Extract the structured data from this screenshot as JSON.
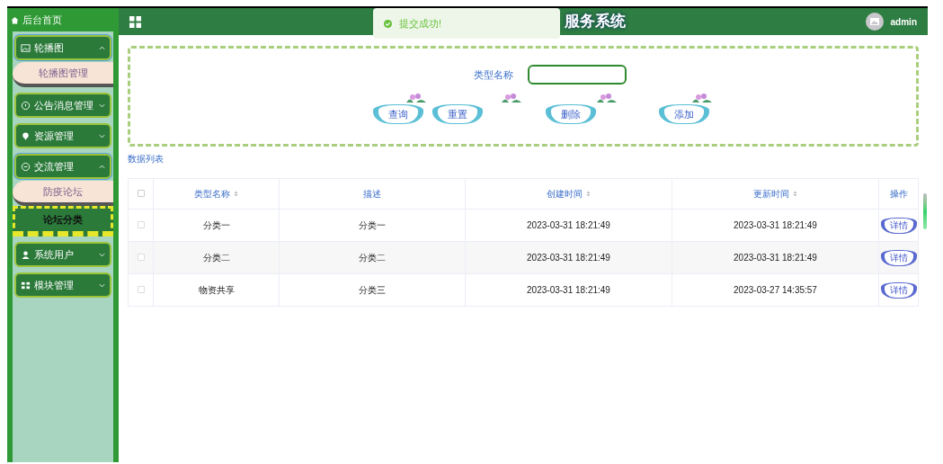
{
  "sidebar": {
    "home": "后台首页",
    "items": [
      {
        "label": "轮播图",
        "kind": "image",
        "expanded": true,
        "children": [
          {
            "label": "轮播图管理",
            "selected": false
          }
        ]
      },
      {
        "label": "公告消息管理",
        "kind": "info",
        "expanded": false
      },
      {
        "label": "资源管理",
        "kind": "pin",
        "expanded": false
      },
      {
        "label": "交流管理",
        "kind": "chat",
        "expanded": true,
        "children": [
          {
            "label": "防疫论坛",
            "selected": false
          },
          {
            "label": "论坛分类",
            "selected": true
          }
        ]
      },
      {
        "label": "系统用户",
        "kind": "user",
        "expanded": false
      },
      {
        "label": "模块管理",
        "kind": "grid",
        "expanded": false
      }
    ]
  },
  "header": {
    "title": "服务系统",
    "user": "admin"
  },
  "toast": {
    "message": "提交成功!"
  },
  "search": {
    "label": "类型名称",
    "buttons": [
      "查询",
      "重置",
      "删除",
      "添加"
    ]
  },
  "list_title": "数据列表",
  "table": {
    "all_checked": false,
    "columns": [
      {
        "label": "类型名称",
        "sortable": true
      },
      {
        "label": "描述",
        "sortable": false
      },
      {
        "label": "创建时间",
        "sortable": true
      },
      {
        "label": "更新时间",
        "sortable": true
      },
      {
        "label": "操作",
        "sortable": false
      }
    ],
    "rows": [
      {
        "checked": false,
        "cells": [
          "分类一",
          "分类一",
          "2023-03-31 18:21:49",
          "2023-03-31 18:21:49"
        ],
        "action": "详情"
      },
      {
        "checked": false,
        "cells": [
          "分类二",
          "分类二",
          "2023-03-31 18:21:49",
          "2023-03-31 18:21:49"
        ],
        "action": "详情"
      },
      {
        "checked": false,
        "cells": [
          "物资共享",
          "分类三",
          "2023-03-31 18:21:49",
          "2023-03-27 14:35:57"
        ],
        "action": "详情"
      }
    ]
  }
}
